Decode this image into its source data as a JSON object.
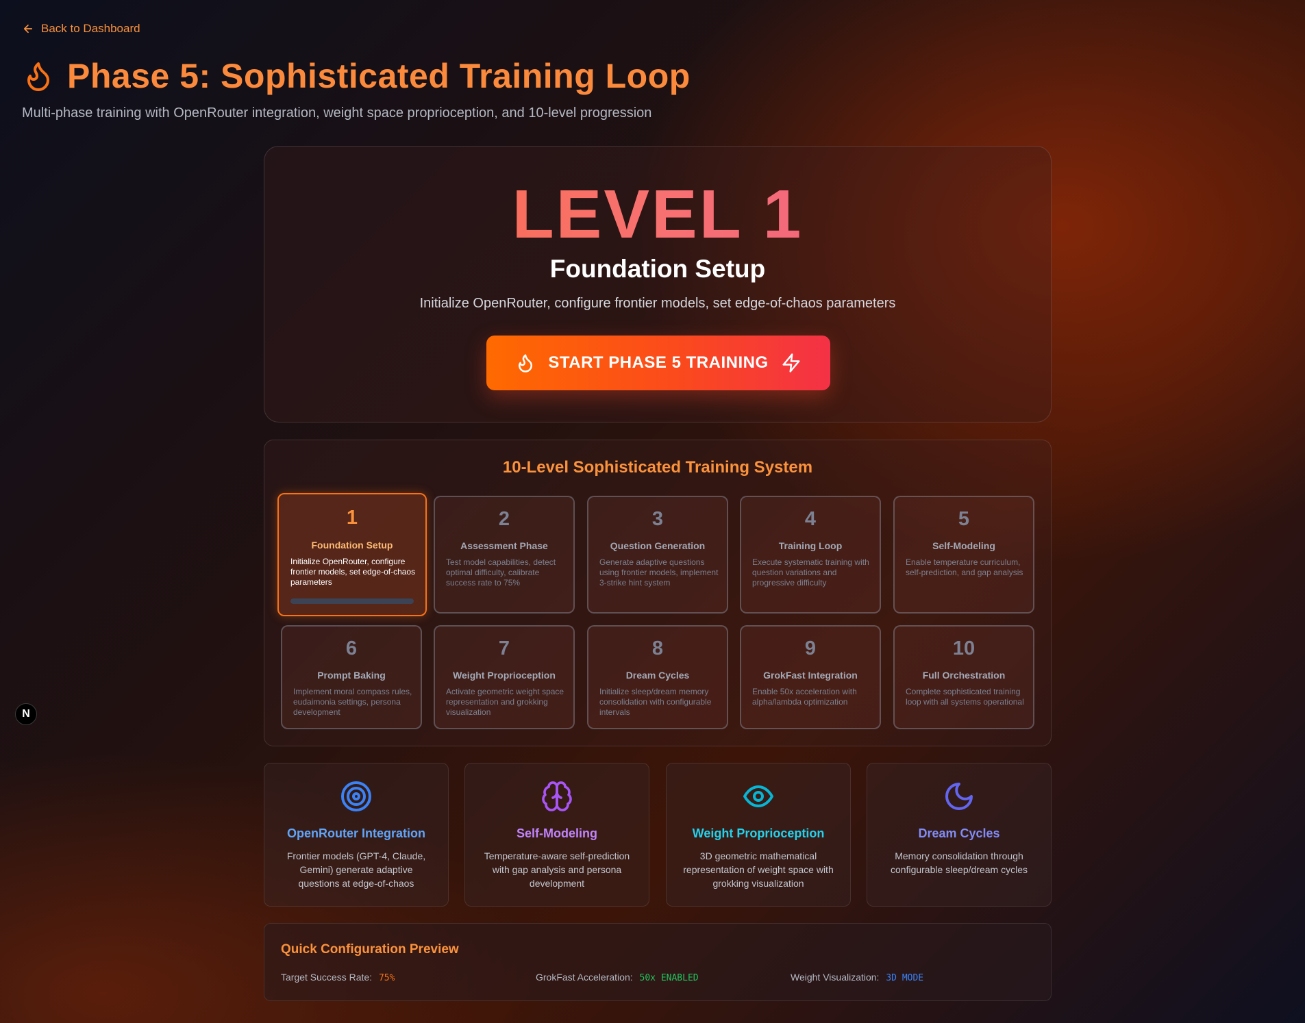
{
  "nav": {
    "back_label": "Back to Dashboard"
  },
  "header": {
    "title": "Phase 5: Sophisticated Training Loop",
    "subtitle": "Multi-phase training with OpenRouter integration, weight space proprioception, and 10-level progression"
  },
  "hero": {
    "level_label": "LEVEL 1",
    "level_name": "Foundation Setup",
    "level_description": "Initialize OpenRouter, configure frontier models, set edge-of-chaos parameters",
    "start_button_label": "START PHASE 5 TRAINING"
  },
  "levels": {
    "title": "10-Level Sophisticated Training System",
    "active_progress": 0,
    "items": [
      {
        "number": "1",
        "name": "Foundation Setup",
        "description": "Initialize OpenRouter, configure frontier models, set edge-of-chaos parameters",
        "active": true
      },
      {
        "number": "2",
        "name": "Assessment Phase",
        "description": "Test model capabilities, detect optimal difficulty, calibrate success rate to 75%"
      },
      {
        "number": "3",
        "name": "Question Generation",
        "description": "Generate adaptive questions using frontier models, implement 3-strike hint system"
      },
      {
        "number": "4",
        "name": "Training Loop",
        "description": "Execute systematic training with question variations and progressive difficulty"
      },
      {
        "number": "5",
        "name": "Self-Modeling",
        "description": "Enable temperature curriculum, self-prediction, and gap analysis"
      },
      {
        "number": "6",
        "name": "Prompt Baking",
        "description": "Implement moral compass rules, eudaimonia settings, persona development"
      },
      {
        "number": "7",
        "name": "Weight Proprioception",
        "description": "Activate geometric weight space representation and grokking visualization"
      },
      {
        "number": "8",
        "name": "Dream Cycles",
        "description": "Initialize sleep/dream memory consolidation with configurable intervals"
      },
      {
        "number": "9",
        "name": "GrokFast Integration",
        "description": "Enable 50x acceleration with alpha/lambda optimization"
      },
      {
        "number": "10",
        "name": "Full Orchestration",
        "description": "Complete sophisticated training loop with all systems operational"
      }
    ]
  },
  "features": [
    {
      "icon": "target-icon",
      "title": "OpenRouter Integration",
      "description": "Frontier models (GPT-4, Claude, Gemini) generate adaptive questions at edge-of-chaos",
      "color": "#3b82f6",
      "title_color": "#60a5fa"
    },
    {
      "icon": "brain-icon",
      "title": "Self-Modeling",
      "description": "Temperature-aware self-prediction with gap analysis and persona development",
      "color": "#a855f7",
      "title_color": "#c084fc"
    },
    {
      "icon": "eye-icon",
      "title": "Weight Proprioception",
      "description": "3D geometric mathematical representation of weight space with grokking visualization",
      "color": "#06b6d4",
      "title_color": "#22d3ee"
    },
    {
      "icon": "moon-icon",
      "title": "Dream Cycles",
      "description": "Memory consolidation through configurable sleep/dream cycles",
      "color": "#6366f1",
      "title_color": "#818cf8"
    }
  ],
  "config": {
    "title": "Quick Configuration Preview",
    "target_label": "Target Success Rate:",
    "target_value": "75%",
    "grokfast_label": "GrokFast Acceleration:",
    "grokfast_value": "50x ENABLED",
    "weight_label": "Weight Visualization:",
    "weight_value": "3D MODE",
    "colors": {
      "target": "#f97316",
      "grokfast": "#22c55e",
      "weight": "#3b82f6"
    }
  },
  "badge": {
    "letter": "N"
  }
}
